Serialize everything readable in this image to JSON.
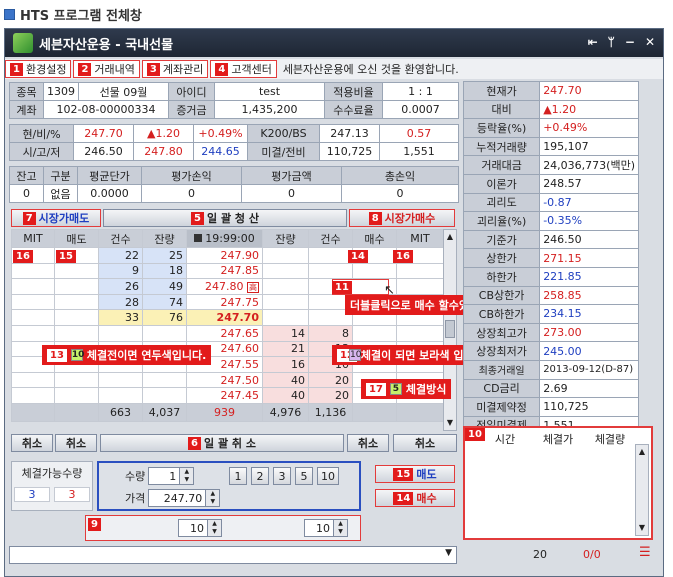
{
  "page_title": "HTS 프로그램 전체창",
  "window": {
    "title": "세븐자산운용 - 국내선물",
    "controls": [
      "⇤",
      "ᛘ",
      "−",
      "✕"
    ]
  },
  "menu": [
    {
      "num": "1",
      "label": "환경설정"
    },
    {
      "num": "2",
      "label": "거래내역"
    },
    {
      "num": "3",
      "label": "계좌관리"
    },
    {
      "num": "4",
      "label": "고객센터"
    }
  ],
  "welcome": "세븐자산운용에 오신 것을 환영합니다.",
  "account": {
    "r1": {
      "l1": "종목",
      "v1": "1309",
      "v2": "선물 09월",
      "l2": "아이디",
      "v3": "test",
      "l3": "적용비율",
      "v4": "1 : 1"
    },
    "r2": {
      "l1": "계좌",
      "v1": "102-08-00000334",
      "l2": "증거금",
      "v2": "1,435,200",
      "l3": "수수료율",
      "v3": "0.0007"
    }
  },
  "quote": {
    "r1": {
      "label": "현/비/%",
      "v1": "247.70",
      "v2": "▲1.20",
      "v3": "+0.49%",
      "label2": "K200/BS",
      "v4": "247.13",
      "v5": "0.57"
    },
    "r2": {
      "label": "시/고/저",
      "v1": "246.50",
      "v2": "247.80",
      "v3": "244.65",
      "label2": "미결/전비",
      "v4": "110,725",
      "v5": "1,551"
    }
  },
  "position": {
    "headers": [
      "잔고",
      "구분",
      "평균단가",
      "평가손익",
      "평가금액",
      "총손익"
    ],
    "values": [
      "0",
      "없음",
      "0.0000",
      "0",
      "0",
      "0"
    ]
  },
  "side": [
    {
      "label": "현재가",
      "value": "247.70",
      "color": "red"
    },
    {
      "label": "대비",
      "value": "▲1.20",
      "color": "red"
    },
    {
      "label": "등락율(%)",
      "value": "+0.49%",
      "color": "red"
    },
    {
      "label": "누적거래량",
      "value": "195,107",
      "color": "black"
    },
    {
      "label": "거래대금",
      "value": "24,036,773(백만)",
      "color": "black"
    },
    {
      "label": "이론가",
      "value": "248.57",
      "color": "black"
    },
    {
      "label": "괴리도",
      "value": "-0.87",
      "color": "blue"
    },
    {
      "label": "괴리율(%)",
      "value": "-0.35%",
      "color": "blue"
    },
    {
      "label": "기준가",
      "value": "246.50",
      "color": "black"
    },
    {
      "label": "상한가",
      "value": "271.15",
      "color": "red"
    },
    {
      "label": "하한가",
      "value": "221.85",
      "color": "blue"
    },
    {
      "label": "CB상한가",
      "value": "258.85",
      "color": "red"
    },
    {
      "label": "CB하한가",
      "value": "234.15",
      "color": "blue"
    },
    {
      "label": "상장최고가",
      "value": "273.00",
      "color": "red"
    },
    {
      "label": "상장최저가",
      "value": "245.00",
      "color": "blue"
    },
    {
      "label": "최종거래일",
      "value": "2013-09-12(D-87)",
      "color": "black"
    },
    {
      "label": "CD금리",
      "value": "2.69",
      "color": "black"
    },
    {
      "label": "미결제약정",
      "value": "110,725",
      "color": "black"
    },
    {
      "label": "전일미결제",
      "value": "1,551",
      "color": "black"
    }
  ],
  "buttons": {
    "market_sell": "시장가매도",
    "liquidate_all": "일 괄 청 산",
    "market_buy": "시장가매수",
    "cancel": "취소",
    "cancel_all": "일 괄 취 소",
    "sell": "매도",
    "buy": "매수"
  },
  "orderbook": {
    "headers": [
      "MIT",
      "매도",
      "건수",
      "잔량",
      "19:99:00",
      "잔량",
      "건수",
      "매수",
      "MIT"
    ],
    "ask_rows": [
      {
        "cnt": "22",
        "qty": "25",
        "price": "247.90"
      },
      {
        "cnt": "9",
        "qty": "18",
        "price": "247.85"
      },
      {
        "cnt": "26",
        "qty": "49",
        "price": "247.80"
      },
      {
        "cnt": "28",
        "qty": "74",
        "price": "247.75"
      },
      {
        "cnt": "33",
        "qty": "76",
        "price": "247.70"
      }
    ],
    "bid_rows": [
      {
        "price": "247.65",
        "qty": "14",
        "cnt": "8"
      },
      {
        "price": "247.60",
        "qty": "21",
        "cnt": "13"
      },
      {
        "price": "247.55",
        "qty": "16",
        "cnt": "10"
      },
      {
        "price": "247.50",
        "qty": "40",
        "cnt": "20"
      },
      {
        "price": "247.45",
        "qty": "40",
        "cnt": "20"
      }
    ],
    "totals": {
      "ask_qty": "663",
      "ask_cnt": "4,037",
      "diff": "939",
      "bid_qty": "4,976",
      "bid_cnt": "1,136"
    }
  },
  "annotations": {
    "a11": "더블클릭으로 매수 할수있습니다.",
    "a12": "체결이 되면 보라색 입니다.",
    "a13": "체결전이면 연두색입니다.",
    "a17": "체결방식"
  },
  "order": {
    "avail_label": "체결가능수량",
    "avail1": "3",
    "avail2": "3",
    "qty_label": "수량",
    "qty_value": "1",
    "price_label": "가격",
    "price_value": "247.70",
    "quick": [
      "1",
      "2",
      "3",
      "5",
      "10"
    ]
  },
  "bottom": {
    "spin1": "10",
    "spin2": "10"
  },
  "fills": {
    "headers": [
      "시간",
      "체결가",
      "체결량"
    ]
  },
  "status": {
    "count": "20",
    "text": "0/0"
  },
  "markers": {
    "m5": "5",
    "m6": "6",
    "m7": "7",
    "m8": "8",
    "m9": "9",
    "m10": "10",
    "m11": "11",
    "m12": "12",
    "m13": "13",
    "m14": "14",
    "m15": "15",
    "m16": "16",
    "m17": "17",
    "sw10": "10",
    "sw5": "5"
  }
}
